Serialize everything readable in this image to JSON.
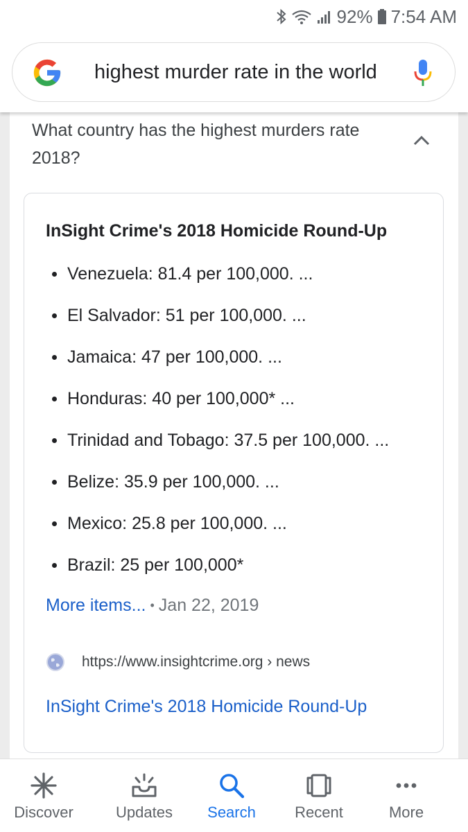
{
  "status_bar": {
    "battery": "92%",
    "time": "7:54 AM"
  },
  "search": {
    "query": "highest murder rate in the world"
  },
  "question": {
    "text": "What country has the highest murders rate 2018?"
  },
  "snippet": {
    "title": "InSight Crime's 2018 Homicide Round-Up",
    "items": [
      "Venezuela: 81.4 per 100,000. ...",
      "El Salvador: 51 per 100,000. ...",
      "Jamaica: 47 per 100,000. ...",
      "Honduras: 40 per 100,000* ...",
      "Trinidad and Tobago: 37.5 per 100,000. ...",
      "Belize: 35.9 per 100,000. ...",
      "Mexico: 25.8 per 100,000. ...",
      "Brazil: 25 per 100,000*"
    ],
    "more_items": "More items...",
    "date": "Jan 22, 2019",
    "source_url": "https://www.insightcrime.org › news",
    "result_link": "InSight Crime's 2018 Homicide Round-Up"
  },
  "bottom_nav": {
    "items": [
      {
        "label": "Discover",
        "icon": "asterisk-icon"
      },
      {
        "label": "Updates",
        "icon": "updates-icon"
      },
      {
        "label": "Search",
        "icon": "search-icon"
      },
      {
        "label": "Recent",
        "icon": "recent-icon"
      },
      {
        "label": "More",
        "icon": "more-icon"
      }
    ],
    "active": "Search"
  },
  "colors": {
    "link_blue": "#1a5fc9",
    "active_blue": "#1a73e8",
    "google_blue": "#4285F4",
    "google_red": "#EA4335",
    "google_yellow": "#FBBC05",
    "google_green": "#34A853"
  }
}
